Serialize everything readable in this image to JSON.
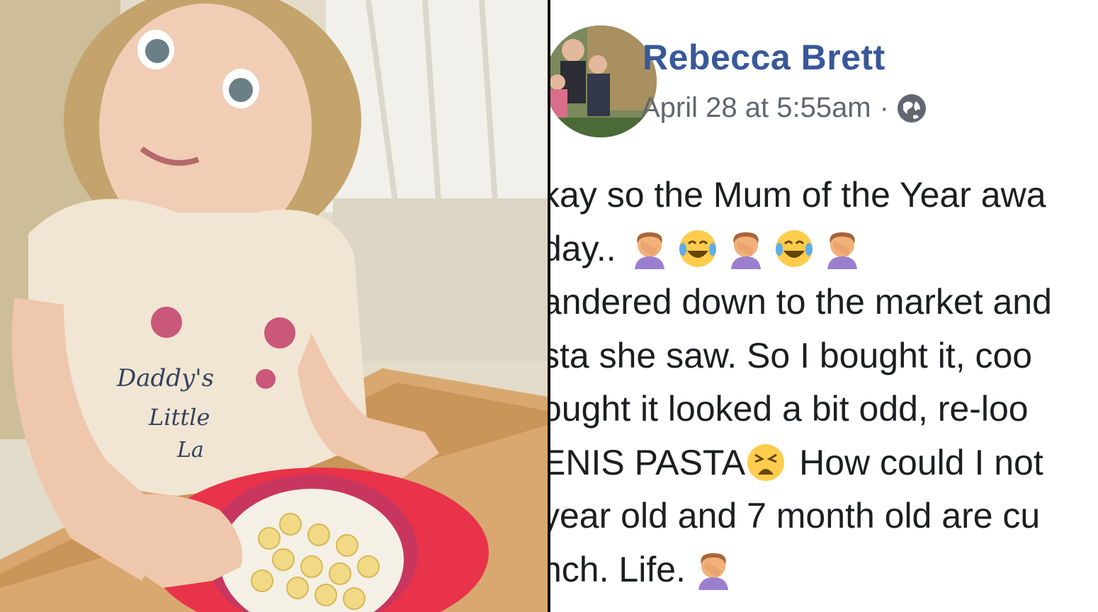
{
  "post": {
    "author": "Rebecca Brett",
    "timestamp": "April 28 at 5:55am",
    "separator": "·",
    "privacy_icon": "globe-icon",
    "lines": [
      "kay so the Mum of the Year awa",
      "day..",
      "andered down to the market and",
      "sta she saw. So I bought it, coo",
      "ought it looked a bit odd, re-loo",
      "ENIS PASTA",
      "year old and 7 month old are cu",
      "nch. Life."
    ],
    "line6_tail": "How could I not",
    "emojis": {
      "line2": [
        "facepalm-emoji",
        "tears-of-joy-emoji",
        "facepalm-emoji",
        "tears-of-joy-emoji",
        "facepalm-emoji"
      ],
      "line6": [
        "tired-face-emoji"
      ],
      "line8": [
        "facepalm-emoji"
      ]
    }
  },
  "photo": {
    "shirt_text": [
      "Daddy's",
      "Little",
      "La"
    ]
  },
  "colors": {
    "author": "#385898",
    "meta": "#616770",
    "text": "#1c1e21"
  }
}
